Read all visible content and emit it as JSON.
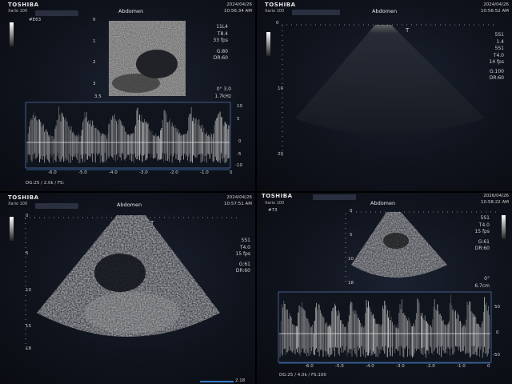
{
  "quad1": {
    "brand": "TOSHIBA",
    "model": "Xario 100",
    "title": "Abdomen",
    "date": "2024/04/26",
    "time": "10:56:34 AM",
    "frame": "#E63",
    "params": [
      "11L4",
      "T8.4",
      "33 fps",
      "G:80",
      "DR:60"
    ],
    "angle": "0° 3.0",
    "scale": "1.7kHz",
    "depth_labels": [
      "0",
      "1",
      "2",
      "3",
      "3.5"
    ],
    "doppler_ticks": [
      "10",
      "5",
      "0",
      "-5",
      "-10"
    ],
    "time_ticks": [
      "-6.0",
      "-5.0",
      "-4.0",
      "-3.0",
      "-2.0",
      "-1.0",
      "0"
    ],
    "footer": "DG:25 / 2.0k / FS:"
  },
  "quad2": {
    "brand": "TOSHIBA",
    "model": "Xario 100",
    "title": "Abdomen",
    "date": "2024/04/26",
    "time": "10:56:52 AM",
    "params": [
      "5S1",
      "1.4",
      "5S1",
      "T4.0",
      "14 fps",
      "G:100",
      "DR:60"
    ],
    "depth_labels": [
      "0",
      "10",
      "20"
    ]
  },
  "quad3": {
    "brand": "TOSHIBA",
    "model": "Xario 100",
    "title": "Abdomen",
    "date": "2024/04/26",
    "time": "10:57:51 AM",
    "params": [
      "5S1",
      "T4.0",
      "15 fps",
      "G:61",
      "DR:60"
    ],
    "depth_labels": [
      "0",
      "5",
      "10",
      "15",
      "18"
    ],
    "footer": "2.18"
  },
  "quad4": {
    "brand": "TOSHIBA",
    "model": "Xario 100",
    "title": "Abdomen",
    "date": "2026/04/26",
    "time": "10:58:22 AM",
    "frame": "#73",
    "params": [
      "5S1",
      "T4.0",
      "15 fps",
      "G:61",
      "DR:60"
    ],
    "depth_labels": [
      "0",
      "5",
      "10",
      "18"
    ],
    "angle": "0°",
    "scale": "6.7cm",
    "doppler_ticks": [
      "50",
      "0",
      "-50"
    ],
    "time_ticks": [
      "-6.0",
      "-5.0",
      "-4.0",
      "-3.0",
      "-2.0",
      "-1.0",
      "0"
    ],
    "footer": "DG:25 / 4.0k / FS:100"
  }
}
